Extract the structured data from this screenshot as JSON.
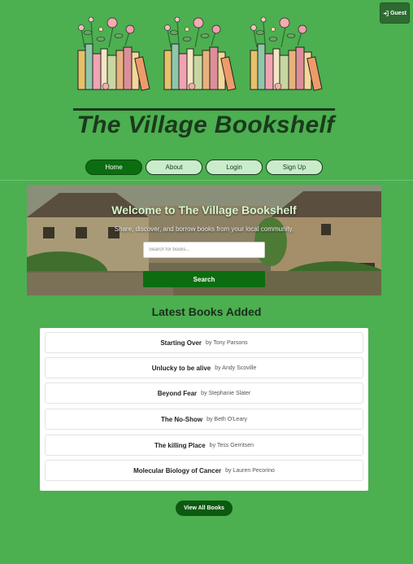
{
  "header": {
    "guest_label": "Guest",
    "site_title": "The Village Bookshelf"
  },
  "nav": {
    "items": [
      {
        "label": "Home",
        "active": true
      },
      {
        "label": "About",
        "active": false
      },
      {
        "label": "Login",
        "active": false
      },
      {
        "label": "Sign Up",
        "active": false
      }
    ]
  },
  "hero": {
    "title": "Welcome to The Village Bookshelf",
    "subtitle": "Share, discover, and borrow books from your local community.",
    "search_placeholder": "Search for books...",
    "search_button": "Search"
  },
  "latest": {
    "heading": "Latest Books Added",
    "books": [
      {
        "title": "Starting Over",
        "author": "by Tony Parsons"
      },
      {
        "title": "Unlucky to be alive",
        "author": "by Andy Scoville"
      },
      {
        "title": "Beyond Fear",
        "author": "by Stephanie Slater"
      },
      {
        "title": "The No-Show",
        "author": "by Beth O'Leary"
      },
      {
        "title": "The killing Place",
        "author": "by Tess Gerritsen"
      },
      {
        "title": "Molecular Biology of Cancer",
        "author": "by Lauren Pecorino"
      }
    ],
    "view_all": "View All Books"
  },
  "colors": {
    "page_bg": "#4caf50",
    "primary_dark_green": "#0b6d10",
    "nav_pill_bg": "#c9eccb",
    "title_color": "#1b3a1c"
  },
  "icons": {
    "guest": "sign-in-icon"
  }
}
